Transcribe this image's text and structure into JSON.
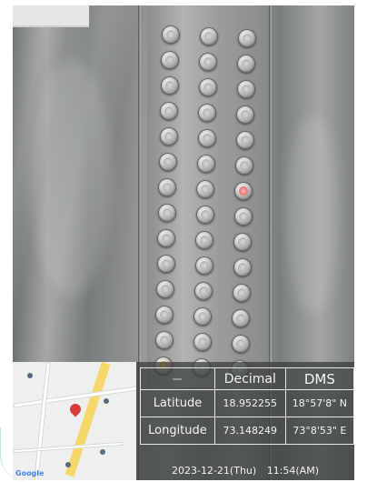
{
  "photo": {
    "subject_icon": "elevator-panel-icon",
    "lit_button_color": "#e04848"
  },
  "geo_overlay": {
    "headers": {
      "decimal": "Decimal",
      "dms": "DMS"
    },
    "rows": [
      {
        "label": "Latitude",
        "decimal": "18.952255",
        "dms": "18°57'8\" N"
      },
      {
        "label": "Longitude",
        "decimal": "73.148249",
        "dms": "73°8'53\" E"
      }
    ],
    "date": "2023-12-21(Thu)",
    "time": "11:54(AM)"
  },
  "map": {
    "attribution": "Google",
    "pin_color": "#d93b3b"
  }
}
